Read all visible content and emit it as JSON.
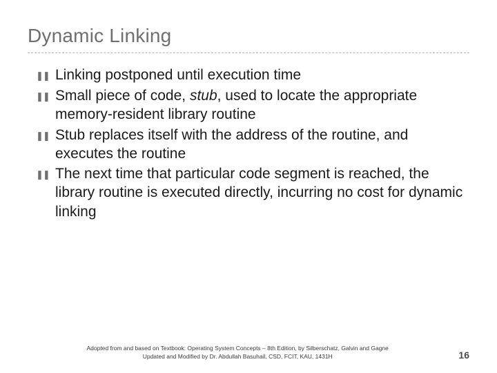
{
  "title": "Dynamic Linking",
  "bullets": [
    {
      "pre": "Linking postponed until execution time",
      "em": "",
      "post": ""
    },
    {
      "pre": "Small piece of code, ",
      "em": "stub",
      "post": ", used to locate the appropriate memory-resident library routine"
    },
    {
      "pre": "Stub replaces itself with the address of the routine, and executes the routine",
      "em": "",
      "post": ""
    },
    {
      "pre": "The next time that particular code segment is reached, the library routine is executed directly, incurring no cost for dynamic linking",
      "em": "",
      "post": ""
    }
  ],
  "footer": {
    "line1": "Adopted from and based on Textbook: Operating System Concepts – 8th Edition, by Silberschatz, Galvin and Gagne",
    "line2": "Updated and Modified by Dr. Abdullah Basuhail, CSD, FCIT, KAU, 1431H"
  },
  "page": "16"
}
